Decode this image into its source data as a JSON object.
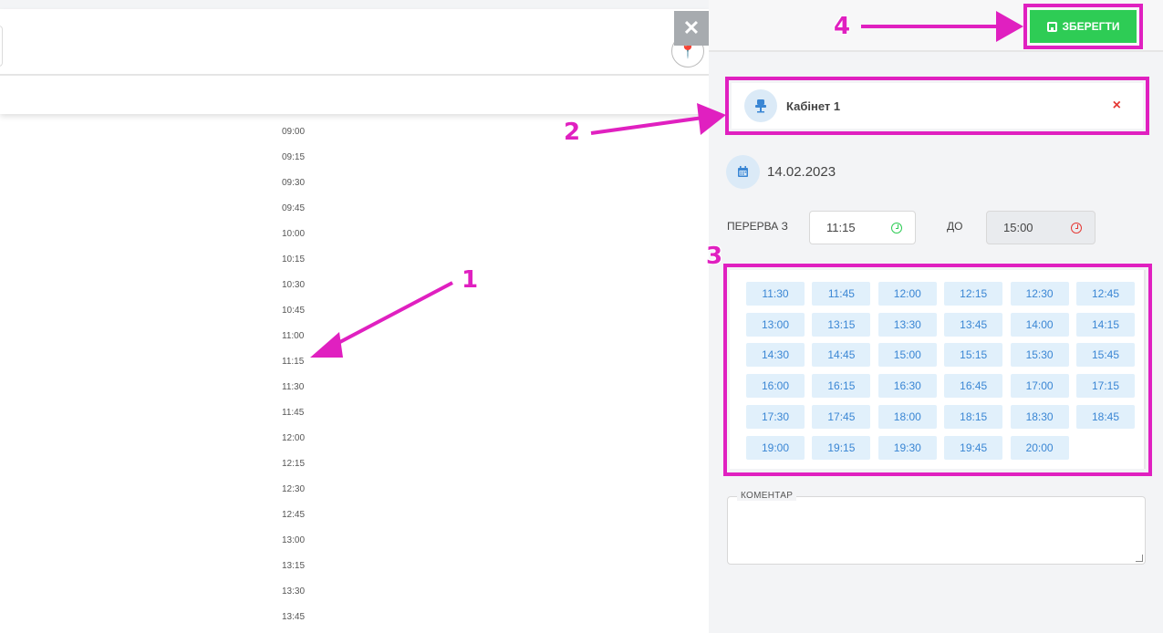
{
  "left": {
    "close_label": "✕",
    "times": [
      "09:00",
      "09:15",
      "09:30",
      "09:45",
      "10:00",
      "10:15",
      "10:30",
      "10:45",
      "11:00",
      "11:15",
      "11:30",
      "11:45",
      "12:00",
      "12:15",
      "12:30",
      "12:45",
      "13:00",
      "13:15",
      "13:30",
      "13:45"
    ]
  },
  "right": {
    "save_label": "ЗБЕРЕГТИ",
    "cabinet": {
      "name": "Кабінет 1",
      "remove": "×"
    },
    "date": "14.02.2023",
    "break_label": "ПЕРЕРВА З",
    "from_time": "11:15",
    "to_label": "ДО",
    "to_time": "15:00",
    "slots": [
      "11:30",
      "11:45",
      "12:00",
      "12:15",
      "12:30",
      "12:45",
      "13:00",
      "13:15",
      "13:30",
      "13:45",
      "14:00",
      "14:15",
      "14:30",
      "14:45",
      "15:00",
      "15:15",
      "15:30",
      "15:45",
      "16:00",
      "16:15",
      "16:30",
      "16:45",
      "17:00",
      "17:15",
      "17:30",
      "17:45",
      "18:00",
      "18:15",
      "18:30",
      "18:45",
      "19:00",
      "19:15",
      "19:30",
      "19:45",
      "20:00"
    ],
    "comment_label": "КОМЕНТАР"
  },
  "annotations": [
    "1",
    "2",
    "3",
    "4"
  ],
  "colors": {
    "annotation": "#e020c0",
    "save": "#2ecc55",
    "slot_bg": "#e1f0fb",
    "slot_text": "#3a86d4"
  }
}
